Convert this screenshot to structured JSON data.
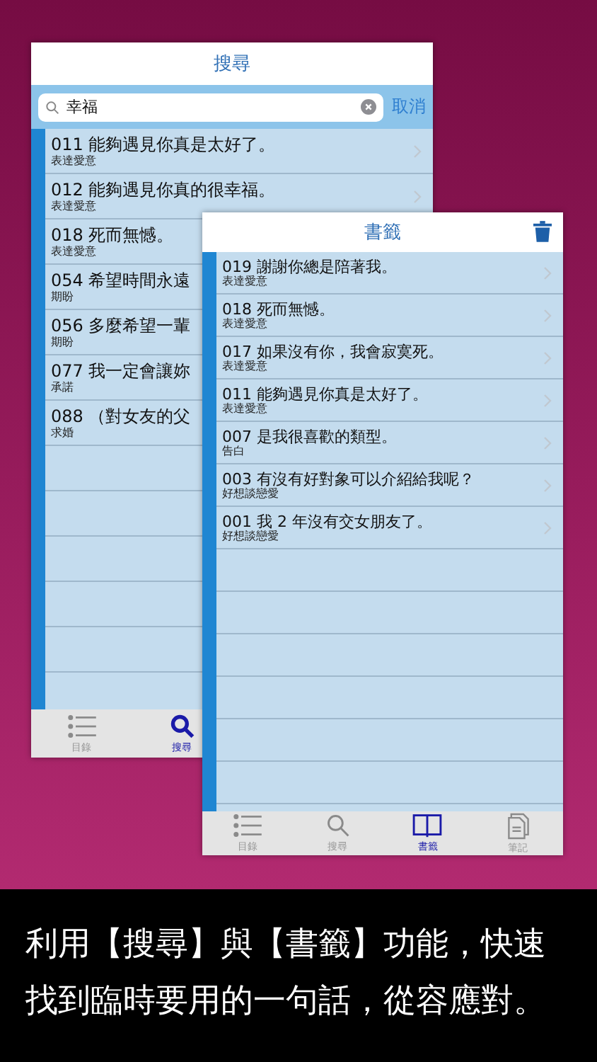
{
  "search_screen": {
    "title": "搜尋",
    "search": {
      "value": "幸福",
      "cancel": "取消"
    },
    "rows": [
      {
        "title": "011 能夠遇見你真是太好了。",
        "category": "表達愛意",
        "chevron": true
      },
      {
        "title": "012 能夠遇見你真的很幸福。",
        "category": "表達愛意",
        "chevron": true
      },
      {
        "title": "018 死而無憾。",
        "category": "表達愛意",
        "chevron": false
      },
      {
        "title": "054 希望時間永遠",
        "category": "期盼",
        "chevron": false
      },
      {
        "title": "056 多麼希望一輩",
        "category": "期盼",
        "chevron": false
      },
      {
        "title": "077 我一定會讓妳",
        "category": "承諾",
        "chevron": false
      },
      {
        "title": "088 （對女友的父",
        "category": "求婚",
        "chevron": false
      }
    ],
    "tabs": [
      {
        "label": "目錄",
        "selected": false
      },
      {
        "label": "搜尋",
        "selected": true
      }
    ]
  },
  "bookmarks_screen": {
    "title": "書籤",
    "rows": [
      {
        "title": "019 謝謝你總是陪著我。",
        "category": "表達愛意",
        "chevron": true
      },
      {
        "title": "018 死而無憾。",
        "category": "表達愛意",
        "chevron": true
      },
      {
        "title": "017 如果沒有你，我會寂寞死。",
        "category": "表達愛意",
        "chevron": true
      },
      {
        "title": "011 能夠遇見你真是太好了。",
        "category": "表達愛意",
        "chevron": true
      },
      {
        "title": "007 是我很喜歡的類型。",
        "category": "告白",
        "chevron": true
      },
      {
        "title": "003 有沒有好對象可以介紹給我呢？",
        "category": "好想談戀愛",
        "chevron": true
      },
      {
        "title": "001 我 2 年沒有交女朋友了。",
        "category": "好想談戀愛",
        "chevron": true
      }
    ],
    "tabs": [
      {
        "label": "目錄",
        "selected": false
      },
      {
        "label": "搜尋",
        "selected": false
      },
      {
        "label": "書籤",
        "selected": true
      },
      {
        "label": "筆記",
        "selected": false
      }
    ]
  },
  "caption": "利用【搜尋】與【書籤】功能，快速找到臨時要用的一句話，從容應對。"
}
